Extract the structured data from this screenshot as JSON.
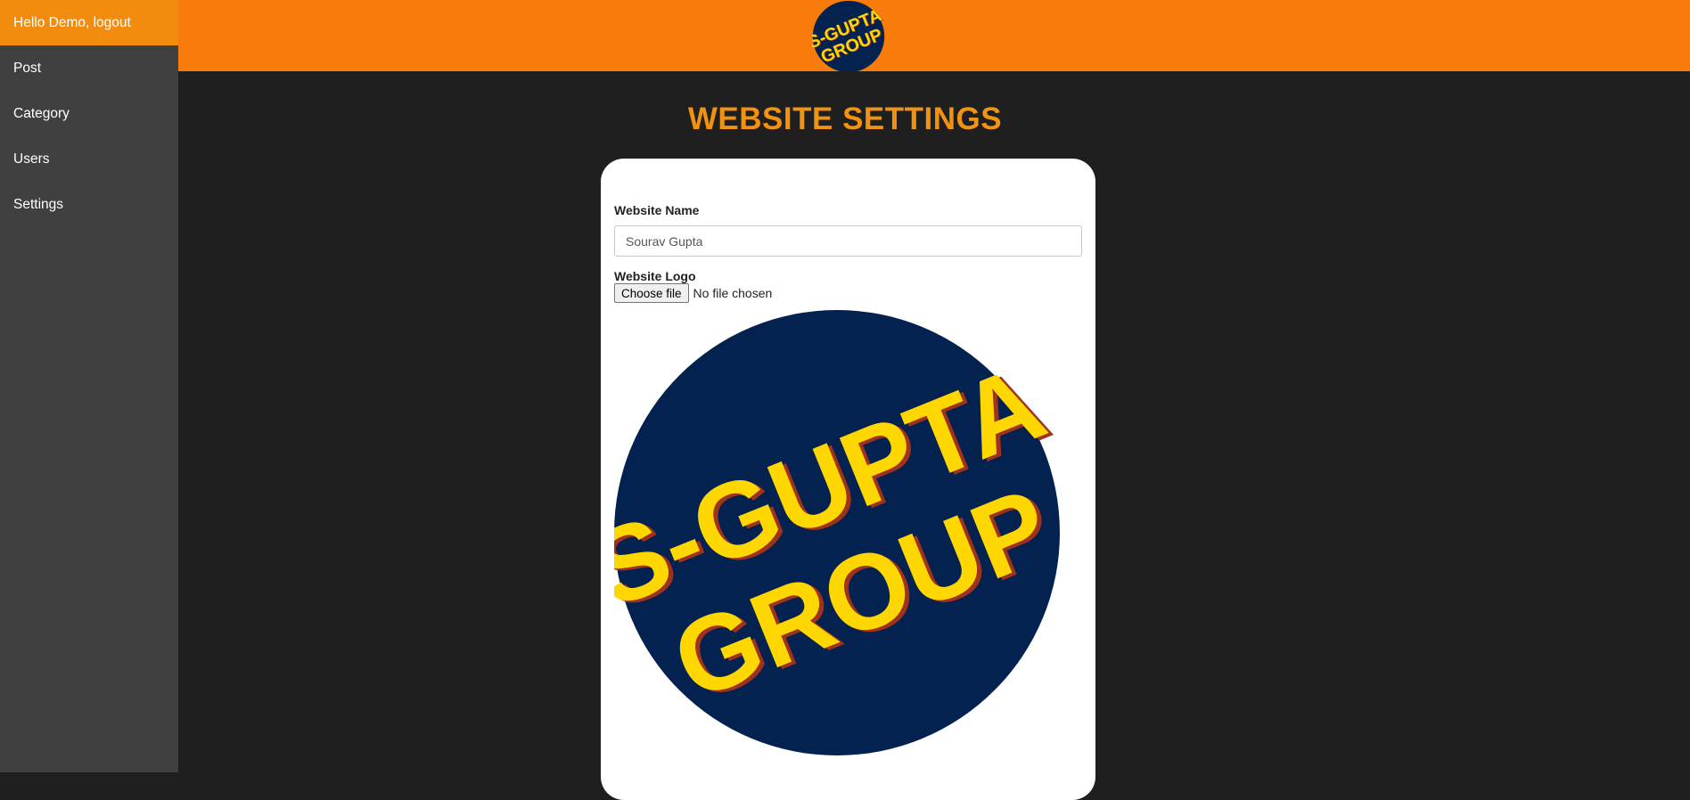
{
  "sidebar": {
    "greeting": "Hello Demo, logout",
    "items": [
      {
        "label": "Post"
      },
      {
        "label": "Category"
      },
      {
        "label": "Users"
      },
      {
        "label": "Settings"
      }
    ]
  },
  "header": {
    "logo_icon": "s-gupta-group-logo",
    "logo_line1": "S-GUPTA",
    "logo_line2": "GROUP"
  },
  "main": {
    "title": "WEBSITE SETTINGS",
    "form": {
      "website_name_label": "Website Name",
      "website_name_value": "Sourav Gupta",
      "website_logo_label": "Website Logo",
      "file_button_label": "Choose file",
      "file_status": "No file chosen"
    }
  },
  "colors": {
    "sidebar_active": "#f18c0e",
    "topbar": "#f77c0c",
    "title": "#f29211",
    "logo_navy": "#04224f",
    "logo_yellow": "#ffd700"
  }
}
